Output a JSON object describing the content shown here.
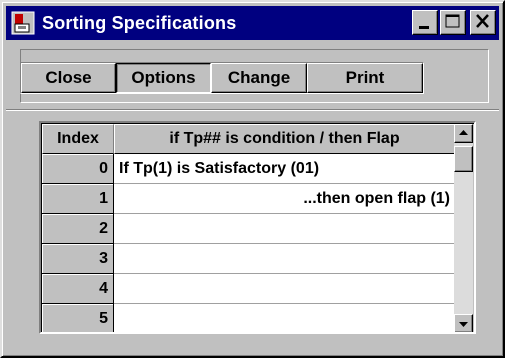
{
  "window": {
    "title": "Sorting Specifications",
    "title_bar_color": "#000080",
    "controls": [
      "minimize-icon",
      "maximize-icon",
      "close-icon"
    ]
  },
  "toolbar": {
    "buttons": [
      {
        "label": "Close",
        "selected": false
      },
      {
        "label": "Options",
        "selected": true
      },
      {
        "label": "Change",
        "selected": false
      },
      {
        "label": "Print",
        "selected": false
      }
    ]
  },
  "table": {
    "columns": [
      "Index",
      "if Tp## is condition / then Flap"
    ],
    "rows": [
      {
        "index": "0",
        "value": "If Tp(1) is Satisfactory (01)",
        "align": "left"
      },
      {
        "index": "1",
        "value": "...then open flap (1)",
        "align": "right"
      },
      {
        "index": "2",
        "value": "",
        "align": "left"
      },
      {
        "index": "3",
        "value": "",
        "align": "left"
      },
      {
        "index": "4",
        "value": "",
        "align": "left"
      },
      {
        "index": "5",
        "value": "",
        "align": "left"
      }
    ]
  }
}
